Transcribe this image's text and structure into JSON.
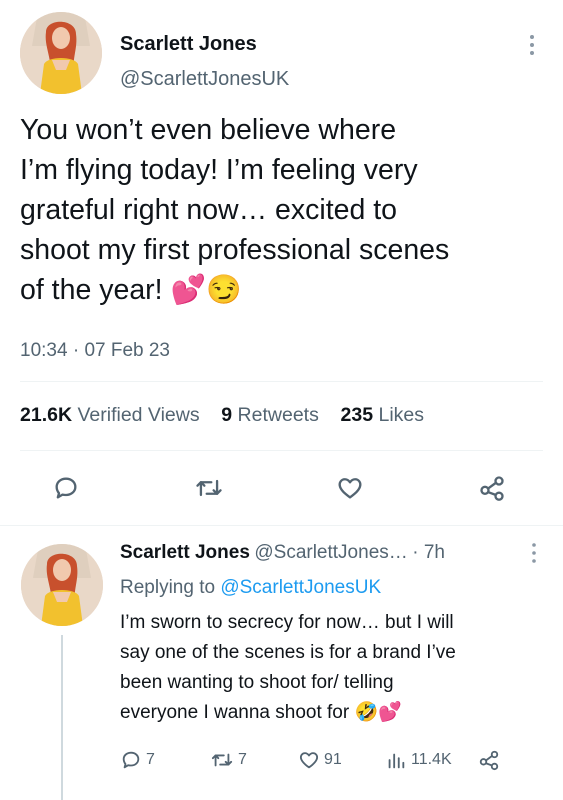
{
  "tweet": {
    "author_name": "Scarlett Jones",
    "author_handle": "@ScarlettJonesUK",
    "text_lines": [
      "You won’t even believe where",
      "I’m flying today! I’m feeling very",
      "grateful right now… excited to",
      "shoot my first professional scenes",
      "of the year!"
    ],
    "emoji_end": "💕😏",
    "time": "10:34",
    "date": "07 Feb 23",
    "views_count": "21.6K",
    "views_label": "Verified Views",
    "retweets_count": "9",
    "retweets_label": "Retweets",
    "likes_count": "235",
    "likes_label": "Likes"
  },
  "reply": {
    "author_name": "Scarlett Jones",
    "author_handle": "@ScarlettJones…",
    "age": "· 7h",
    "replying_prefix": "Replying to",
    "replying_handle": "@ScarlettJonesUK",
    "text_lines": [
      "I’m sworn to secrecy for now… but I will",
      "say one of the scenes is for a brand I’ve",
      "been wanting to shoot for/ telling",
      "everyone I wanna shoot for"
    ],
    "emoji_end": "🤣💕",
    "replies": "7",
    "retweets": "7",
    "likes": "91",
    "views": "11.4K"
  },
  "icons": {
    "reply": "speech-bubble-icon",
    "retweet": "retweet-arrows-icon",
    "like": "heart-icon",
    "share": "share-nodes-icon",
    "views": "bar-chart-icon",
    "more": "vertical-dots-icon"
  }
}
